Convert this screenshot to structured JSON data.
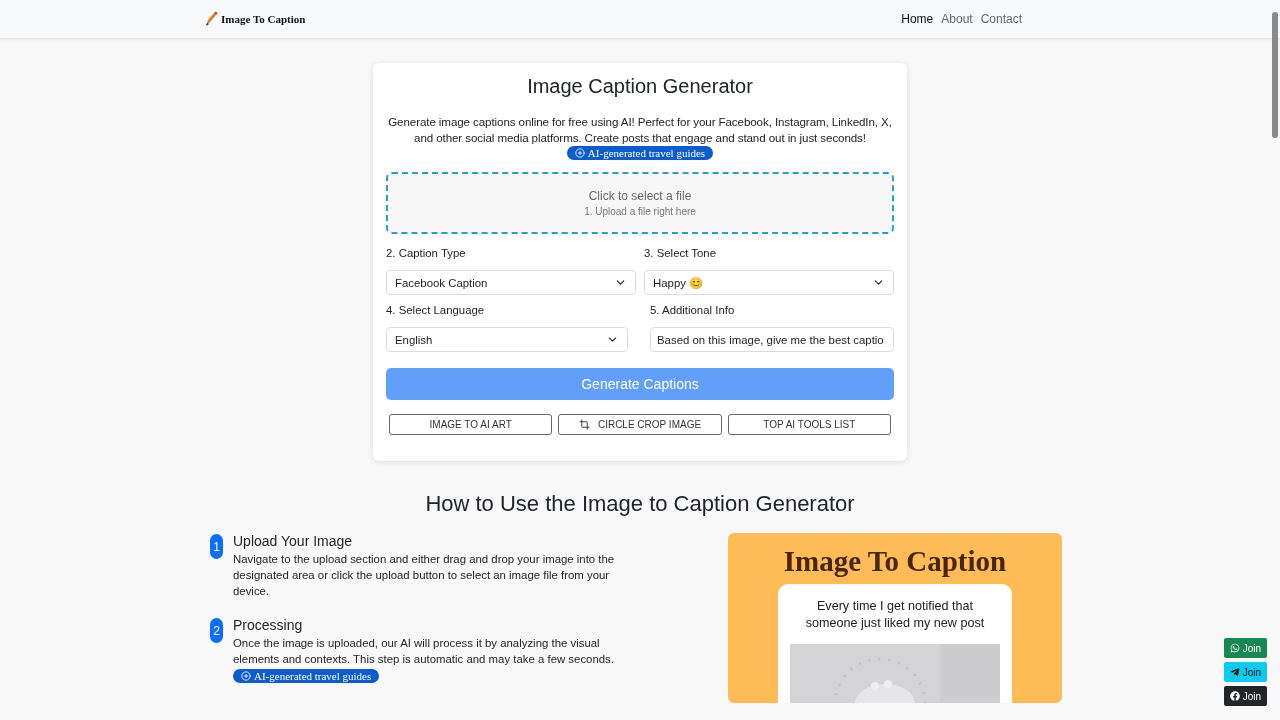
{
  "brand": {
    "name": "Image To Caption"
  },
  "nav": [
    {
      "label": "Home",
      "selected": true
    },
    {
      "label": "About",
      "selected": false
    },
    {
      "label": "Contact",
      "selected": false
    }
  ],
  "tool": {
    "title": "Image Caption Generator",
    "description": "Generate image captions online for free using AI! Perfect for your Facebook, Instagram, LinkedIn, X, and other social media platforms. Create posts that engage and stand out in just seconds!",
    "promo": "AI-generated travel guides",
    "upload": {
      "title": "Click to select a file",
      "hint": "1. Upload a file right here"
    },
    "fields": [
      {
        "kind": "select",
        "label": "2. Caption Type",
        "value": "Facebook Caption"
      },
      {
        "kind": "select",
        "label": "3. Select Tone",
        "value": "Happy 😊"
      },
      {
        "kind": "select",
        "label": "4. Select Language",
        "value": "English"
      },
      {
        "kind": "input",
        "label": "5. Additional Info",
        "value": "Based on this image, give me the best captio"
      }
    ],
    "submit": "Generate Captions",
    "links": [
      {
        "label": "IMAGE TO AI ART",
        "icon": false
      },
      {
        "label": "CIRCLE CROP IMAGE",
        "icon": true
      },
      {
        "label": "TOP AI TOOLS LIST",
        "icon": false
      }
    ]
  },
  "how_to": {
    "title": "How to Use the Image to Caption Generator",
    "steps": [
      {
        "number": "1",
        "title": "Upload Your Image",
        "text": "Navigate to the upload section and either drag and drop your image into the designated area or click the upload button to select an image file from your device."
      },
      {
        "number": "2",
        "title": "Processing",
        "text": "Once the image is uploaded, our AI will process it by analyzing the visual elements and contexts. This step is automatic and may take a few seconds.",
        "promo": "AI-generated travel guides"
      }
    ],
    "preview": {
      "title": "Image To Caption",
      "caption": "Every time I get notified that someone just liked my new post"
    }
  },
  "join": [
    {
      "kind": "whatsapp",
      "label": "Join",
      "color": "#198754"
    },
    {
      "kind": "telegram",
      "label": "Join",
      "color": "#0dcaf0"
    },
    {
      "kind": "facebook",
      "label": "Join",
      "color": "#212529"
    }
  ]
}
